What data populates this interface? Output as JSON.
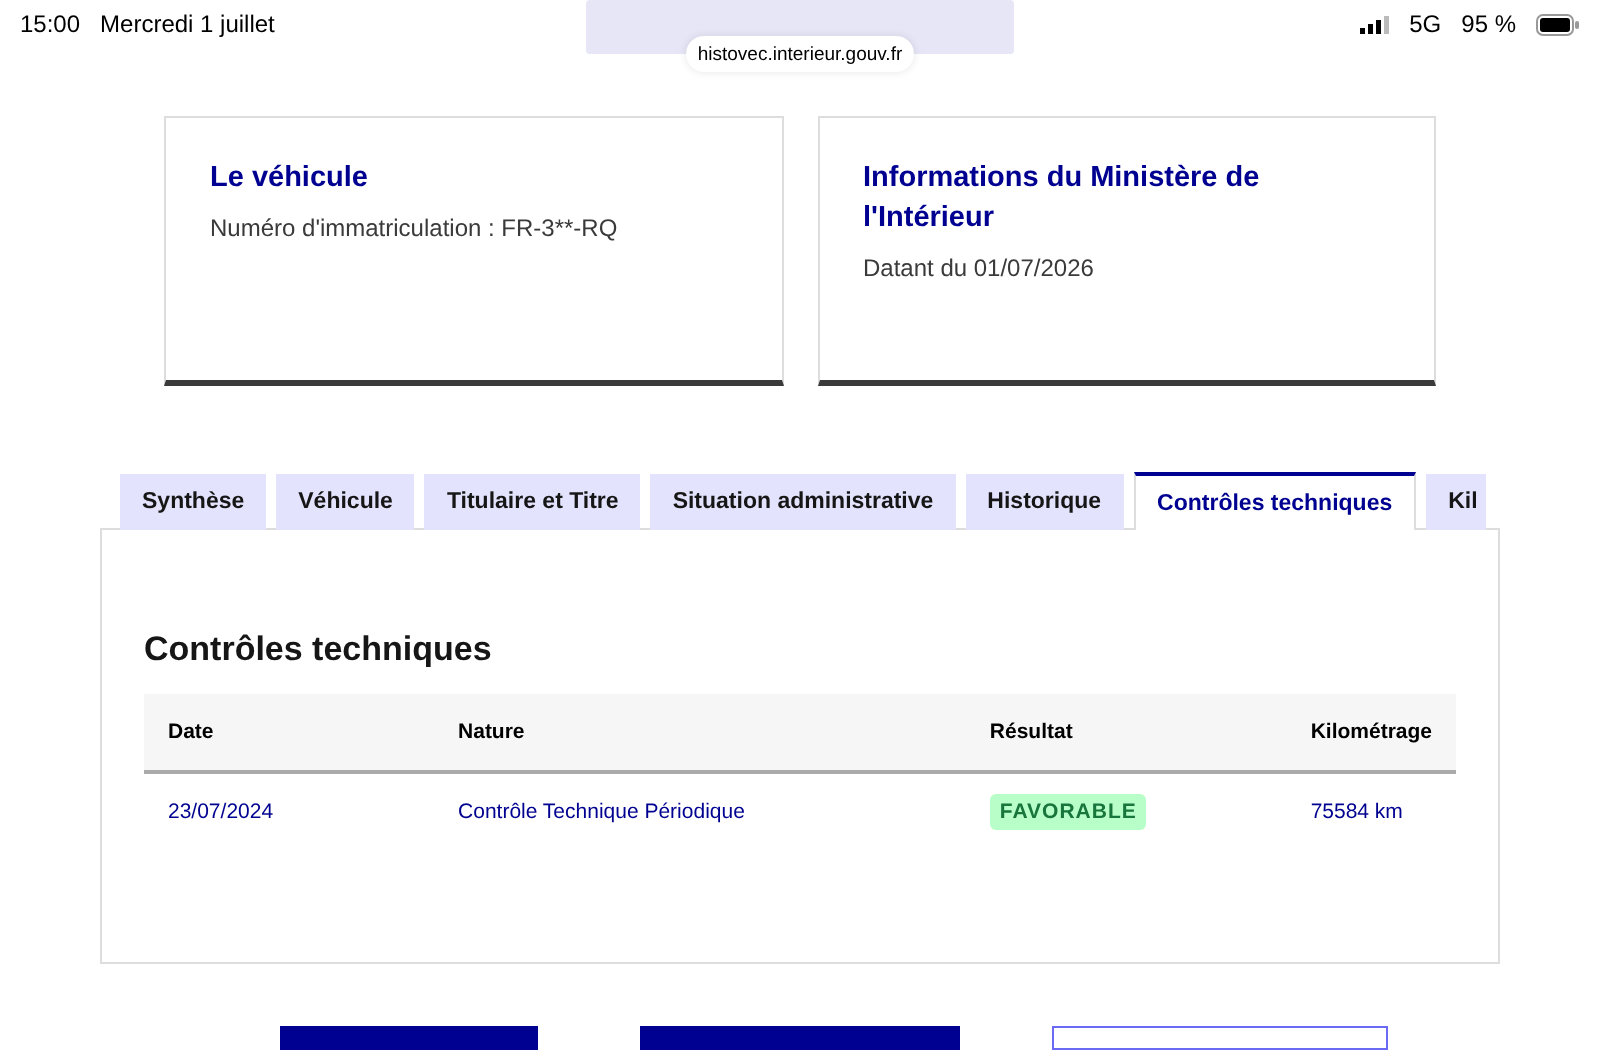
{
  "status_bar": {
    "time": "15:00",
    "date": "Mercredi 1 juillet",
    "network": "5G",
    "battery": "95 %"
  },
  "address_bar": {
    "url": "histovec.interieur.gouv.fr"
  },
  "cards": [
    {
      "title": "Le véhicule",
      "text": "Numéro d'immatriculation : FR-3**-RQ"
    },
    {
      "title": "Informations du Ministère de l'Intérieur",
      "text": "Datant du 01/07/2026"
    }
  ],
  "tabs": [
    {
      "label": "Synthèse",
      "selected": false
    },
    {
      "label": "Véhicule",
      "selected": false
    },
    {
      "label": "Titulaire et Titre",
      "selected": false
    },
    {
      "label": "Situation administrative",
      "selected": false
    },
    {
      "label": "Historique",
      "selected": false
    },
    {
      "label": "Contrôles techniques",
      "selected": true
    },
    {
      "label": "Kil",
      "selected": false
    }
  ],
  "section_title": "Contrôles techniques",
  "table": {
    "columns": [
      "Date",
      "Nature",
      "Résultat",
      "Kilométrage"
    ],
    "rows": [
      {
        "cells": [
          {
            "kind": "text",
            "text": "23/07/2024"
          },
          {
            "kind": "text",
            "text": "Contrôle Technique Périodique"
          },
          {
            "kind": "badge",
            "text": "FAVORABLE"
          },
          {
            "kind": "text",
            "text": "75584 km"
          }
        ]
      }
    ]
  },
  "bottom_buttons": [
    {
      "kind": "primary"
    },
    {
      "kind": "primary"
    },
    {
      "kind": "secondary"
    }
  ]
}
